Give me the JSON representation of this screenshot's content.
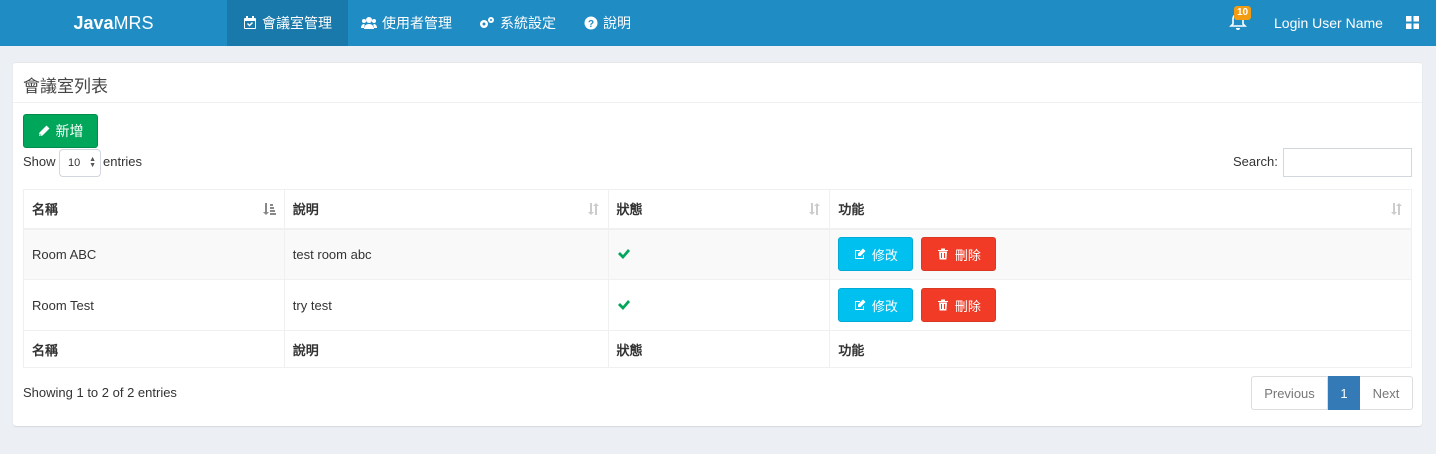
{
  "brand": {
    "bold": "Java",
    "rest": "MRS"
  },
  "nav": [
    {
      "label": "會議室管理",
      "icon": "calendar-check-icon",
      "active": true
    },
    {
      "label": "使用者管理",
      "icon": "users-icon"
    },
    {
      "label": "系統設定",
      "icon": "gears-icon"
    },
    {
      "label": "說明",
      "icon": "question-circle-icon"
    }
  ],
  "notifications": {
    "count": "10",
    "icon": "bell-icon"
  },
  "user": {
    "name": "Login User Name"
  },
  "panel": {
    "title": "會議室列表",
    "add_label": "新增"
  },
  "length": {
    "show": "Show",
    "value": "10",
    "entries": "entries"
  },
  "search": {
    "label": "Search:",
    "value": ""
  },
  "table": {
    "columns": [
      "名稱",
      "說明",
      "狀態",
      "功能"
    ],
    "rows": [
      {
        "name": "Room ABC",
        "desc": "test room abc",
        "status": "active",
        "edit": "修改",
        "delete": "刪除"
      },
      {
        "name": "Room Test",
        "desc": "try test",
        "status": "active",
        "edit": "修改",
        "delete": "刪除"
      }
    ]
  },
  "info": "Showing 1 to 2 of 2 entries",
  "pagination": {
    "previous": "Previous",
    "current": "1",
    "next": "Next"
  },
  "colors": {
    "navbar": "#1f8cc4",
    "add": "#00a65a",
    "edit": "#00c0ef",
    "delete": "#f13b26",
    "check": "#00a65a",
    "page_active": "#337ab7"
  }
}
